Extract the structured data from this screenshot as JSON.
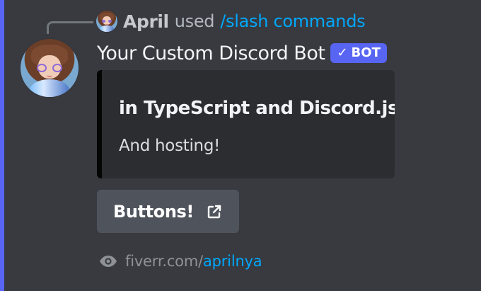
{
  "reply": {
    "username": "April",
    "used_text": "used",
    "command_text": "/slash commands"
  },
  "message": {
    "bot_name": "Your Custom Discord Bot",
    "bot_badge": "BOT"
  },
  "embed": {
    "title": "in TypeScript and Discord.js",
    "description": "And hosting!"
  },
  "button": {
    "label": "Buttons!"
  },
  "footer": {
    "prefix": "fiverr.com/",
    "handle": "aprilnya"
  },
  "icons": {
    "check": "checkmark-icon",
    "external_link": "external-link-icon",
    "eye": "eye-icon"
  },
  "colors": {
    "background": "#383a40",
    "mention_bar": "#5865f2",
    "embed_background": "#2b2d31",
    "embed_accent": "#050505",
    "button_background": "#4f545c",
    "link": "#00a8fc",
    "badge": "#5865f2"
  }
}
